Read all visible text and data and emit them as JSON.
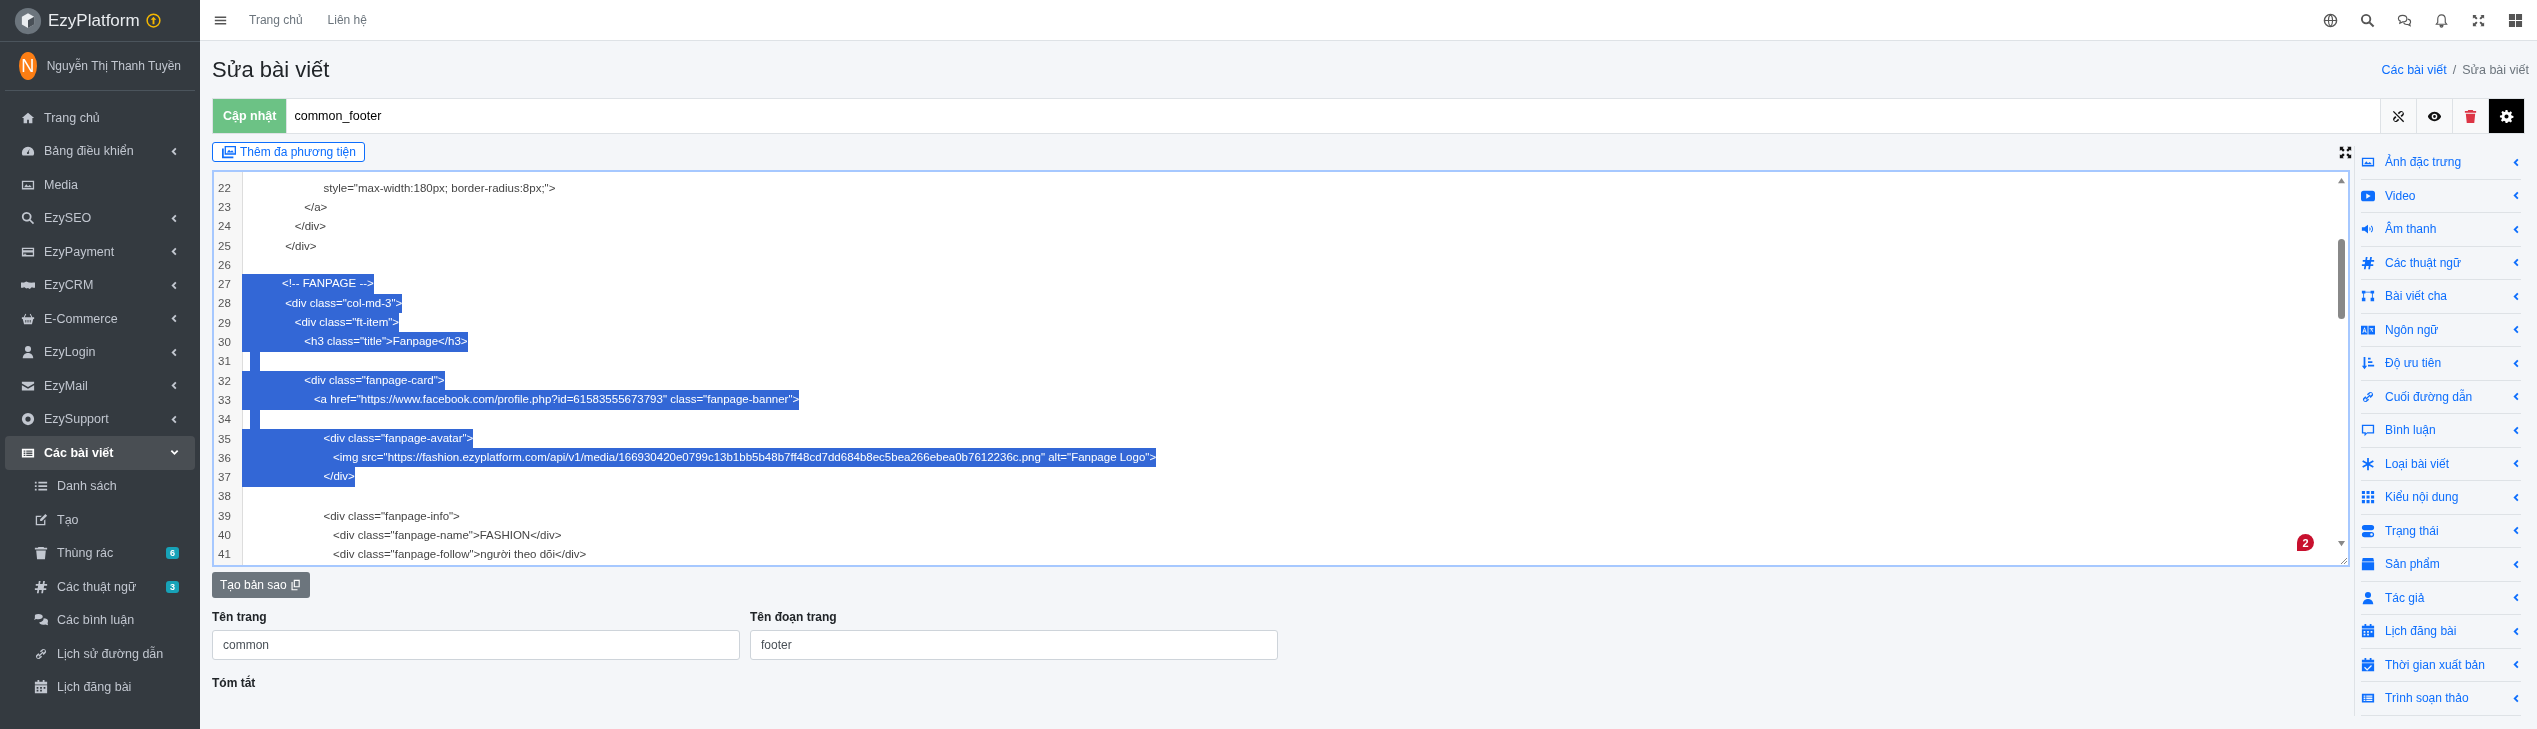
{
  "sidebar": {
    "brand": "EzyPlatform",
    "user": {
      "initial": "N",
      "name": "Nguyễn Thị Thanh Tuyền"
    },
    "menu": [
      {
        "label": "Trang chủ",
        "has_submenu": false,
        "selected": false
      },
      {
        "label": "Bảng điều khiển",
        "has_submenu": true,
        "expanded": false,
        "selected": false
      },
      {
        "label": "Media",
        "has_submenu": false,
        "selected": false
      },
      {
        "label": "EzySEO",
        "has_submenu": true,
        "expanded": false,
        "selected": false
      },
      {
        "label": "EzyPayment",
        "has_submenu": true,
        "expanded": false,
        "selected": false
      },
      {
        "label": "EzyCRM",
        "has_submenu": true,
        "expanded": false,
        "selected": false
      },
      {
        "label": "E-Commerce",
        "has_submenu": true,
        "expanded": false,
        "selected": false
      },
      {
        "label": "EzyLogin",
        "has_submenu": true,
        "expanded": false,
        "selected": false
      },
      {
        "label": "EzyMail",
        "has_submenu": true,
        "expanded": false,
        "selected": false
      },
      {
        "label": "EzySupport",
        "has_submenu": true,
        "expanded": false,
        "selected": false
      },
      {
        "label": "Các bài viết",
        "has_submenu": true,
        "expanded": true,
        "selected": true,
        "children": [
          {
            "label": "Danh sách"
          },
          {
            "label": "Tạo"
          },
          {
            "label": "Thùng rác",
            "badge": "6"
          },
          {
            "label": "Các thuật ngữ",
            "badge": "3"
          },
          {
            "label": "Các bình luận"
          },
          {
            "label": "Lịch sử đường dẫn"
          },
          {
            "label": "Lịch đăng bài"
          }
        ]
      }
    ]
  },
  "topbar": {
    "links": [
      "Trang chủ",
      "Liên hệ"
    ]
  },
  "page": {
    "title": "Sửa bài viết",
    "breadcrumb_separator": "/",
    "breadcrumb": [
      {
        "label": "Các bài viết",
        "kind": "link"
      },
      {
        "label": "Sửa bài viết",
        "kind": "current"
      }
    ]
  },
  "toolbar": {
    "submit": "Cập nhật",
    "title_value": "common_footer"
  },
  "editor": {
    "media_button": "Thêm đa phương tiện",
    "notification_count": "2",
    "lines": [
      {
        "number": "22",
        "text": "                       style=\"max-width:180px; border-radius:8px;\">",
        "selected": false
      },
      {
        "number": "23",
        "text": "                 </a>",
        "selected": false
      },
      {
        "number": "24",
        "text": "              </div>",
        "selected": false
      },
      {
        "number": "25",
        "text": "           </div>",
        "selected": false
      },
      {
        "number": "26",
        "selected": false
      },
      {
        "number": "27",
        "text": "          <!-- FANPAGE -->",
        "selected": true
      },
      {
        "number": "28",
        "text": "           <div class=\"col-md-3\">",
        "selected": true
      },
      {
        "number": "29",
        "text": "              <div class=\"ft-item\">",
        "selected": true
      },
      {
        "number": "30",
        "text": "                 <h3 class=\"title\">Fanpage</h3>",
        "selected": true
      },
      {
        "number": "31",
        "selected": true
      },
      {
        "number": "32",
        "text": "                 <div class=\"fanpage-card\">",
        "selected": true
      },
      {
        "number": "33",
        "text": "                    <a href=\"https://www.facebook.com/profile.php?id=61583555673793\" class=\"fanpage-banner\">",
        "selected": true
      },
      {
        "number": "34",
        "selected": true
      },
      {
        "number": "35",
        "text": "                       <div class=\"fanpage-avatar\">",
        "selected": true
      },
      {
        "number": "36",
        "text": "                          <img src=\"https://fashion.ezyplatform.com/api/v1/media/166930420e0799c13b1bb5b48b7ff48cd7dd684b8ec5bea266ebea0b7612236c.png\" alt=\"Fanpage Logo\">",
        "selected": true
      },
      {
        "number": "37",
        "text": "                       </div>",
        "selected": true
      },
      {
        "number": "38",
        "selected": false
      },
      {
        "number": "39",
        "text": "                       <div class=\"fanpage-info\">",
        "selected": false
      },
      {
        "number": "40",
        "text": "                          <div class=\"fanpage-name\">FASHION</div>",
        "selected": false
      },
      {
        "number": "41",
        "text": "                          <div class=\"fanpage-follow\">người theo dõi</div>",
        "selected": false
      }
    ]
  },
  "copy_button": "Tạo bản sao",
  "fields": [
    {
      "label": "Tên trang",
      "value": "common"
    },
    {
      "label": "Tên đoạn trang",
      "value": "footer"
    }
  ],
  "summary_label": "Tóm tắt",
  "side_panel": [
    "Ảnh đặc trưng",
    "Video",
    "Âm thanh",
    "Các thuật ngữ",
    "Bài viết cha",
    "Ngôn ngữ",
    "Độ ưu tiên",
    "Cuối đường dẫn",
    "Bình luận",
    "Loại bài viết",
    "Kiểu nội dung",
    "Trạng thái",
    "Sản phẩm",
    "Tác giả",
    "Lịch đăng bài",
    "Thời gian xuất bản",
    "Trình soạn thảo"
  ]
}
